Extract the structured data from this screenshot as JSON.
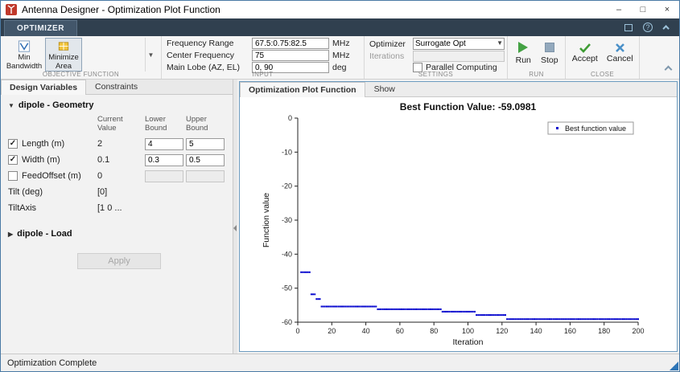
{
  "window": {
    "title": "Antenna Designer - Optimization Plot Function",
    "controls": {
      "minimize": "–",
      "maximize": "□",
      "close": "×"
    }
  },
  "toolstrip": {
    "tab": "OPTIMIZER",
    "help": "?"
  },
  "ribbon": {
    "objective": {
      "label": "OBJECTIVE FUNCTION",
      "buttons": [
        {
          "label": "Min Bandwidth"
        },
        {
          "label": "Minimize Area"
        }
      ]
    },
    "input": {
      "label": "INPUT",
      "fields": [
        {
          "label": "Frequency Range",
          "value": "67.5:0.75:82.5",
          "unit": "MHz"
        },
        {
          "label": "Center Frequency",
          "value": "75",
          "unit": "MHz"
        },
        {
          "label": "Main Lobe (AZ, EL)",
          "value": "0, 90",
          "unit": "deg"
        }
      ]
    },
    "settings": {
      "label": "SETTINGS",
      "optimizer_label": "Optimizer",
      "optimizer_value": "Surrogate Opt",
      "iterations_label": "Iterations",
      "iterations_value": "",
      "parallel_label": "Parallel Computing"
    },
    "run": {
      "label": "RUN",
      "run": "Run",
      "stop": "Stop"
    },
    "close": {
      "label": "CLOSE",
      "accept": "Accept",
      "cancel": "Cancel"
    }
  },
  "left_panel": {
    "tabs": [
      {
        "label": "Design Variables"
      },
      {
        "label": "Constraints"
      }
    ],
    "sections": {
      "geometry": "dipole - Geometry",
      "load": "dipole - Load"
    },
    "columns": [
      "Current Value",
      "Lower Bound",
      "Upper Bound"
    ],
    "rows": [
      {
        "label": "Length (m)",
        "checked": true,
        "current": "2",
        "lower": "4",
        "upper": "5"
      },
      {
        "label": "Width (m)",
        "checked": true,
        "current": "0.1",
        "lower": "0.3",
        "upper": "0.5"
      },
      {
        "label": "FeedOffset (m)",
        "checked": false,
        "current": "0",
        "lower": "",
        "upper": ""
      },
      {
        "label": "Tilt (deg)",
        "current": "[0]"
      },
      {
        "label": "TiltAxis",
        "current": "[1  0 ..."
      }
    ],
    "apply": "Apply"
  },
  "plot_panel": {
    "tabs": [
      {
        "label": "Optimization Plot Function"
      },
      {
        "label": "Show"
      }
    ]
  },
  "status_bar": {
    "text": "Optimization Complete"
  },
  "chart_data": {
    "type": "scatter",
    "title": "Best Function Value: -59.0981",
    "best_value": -59.0981,
    "xlabel": "Iteration",
    "ylabel": "Function value",
    "xlim": [
      0,
      200
    ],
    "ylim": [
      -60,
      0
    ],
    "xticks": [
      0,
      20,
      40,
      60,
      80,
      100,
      120,
      140,
      160,
      180,
      200
    ],
    "yticks": [
      0,
      -10,
      -20,
      -30,
      -40,
      -50,
      -60
    ],
    "legend": [
      "Best function value"
    ],
    "legend_position": "top-right",
    "grid": false,
    "marker_color": "#0000cd",
    "segments": [
      {
        "x_start": 2,
        "x_end": 7,
        "y": -45.3
      },
      {
        "x_start": 8,
        "x_end": 10,
        "y": -51.8
      },
      {
        "x_start": 11,
        "x_end": 13,
        "y": -53.2
      },
      {
        "x_start": 14,
        "x_end": 46,
        "y": -55.4
      },
      {
        "x_start": 47,
        "x_end": 84,
        "y": -56.2
      },
      {
        "x_start": 85,
        "x_end": 104,
        "y": -56.9
      },
      {
        "x_start": 105,
        "x_end": 122,
        "y": -57.9
      },
      {
        "x_start": 123,
        "x_end": 200,
        "y": -59.1
      }
    ]
  }
}
